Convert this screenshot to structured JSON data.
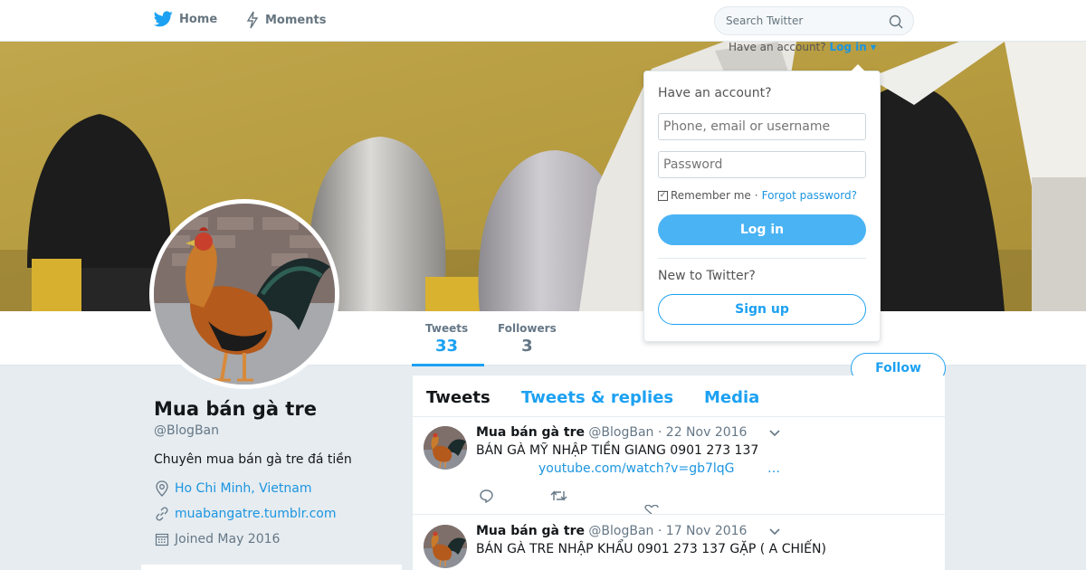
{
  "nav": {
    "home": "Home",
    "moments": "Moments",
    "search_placeholder": "Search Twitter"
  },
  "login_prompt": {
    "have_account": "Have an account?",
    "login": "Log in"
  },
  "dropdown": {
    "title": "Have an account?",
    "username_placeholder": "Phone, email or username",
    "password_placeholder": "Password",
    "remember": "Remember me",
    "separator": "·",
    "forgot": "Forgot password?",
    "login_button": "Log in",
    "new_to": "New to Twitter?",
    "signup_button": "Sign up"
  },
  "stats": {
    "tweets_label": "Tweets",
    "tweets_value": "33",
    "followers_label": "Followers",
    "followers_value": "3"
  },
  "follow_button": "Follow",
  "profile": {
    "name": "Mua bán gà tre",
    "handle": "@BlogBan",
    "bio": "Chuyên mua bán gà tre đá tiền",
    "location": "Ho Chi Minh, Vietnam",
    "url": "muabangatre.tumblr.com",
    "joined": "Joined May 2016"
  },
  "timeline_tabs": [
    "Tweets",
    "Tweets & replies",
    "Media"
  ],
  "tweets": [
    {
      "name": "Mua bán gà tre",
      "handle": "@BlogBan",
      "date": "· 22 Nov 2016",
      "text": "BÁN GÀ MỸ NHẬP TIỀN GIANG 0901 273 137",
      "link": "youtube.com/watch?v=gb7lqG",
      "ellipsis": "…"
    },
    {
      "name": "Mua bán gà tre",
      "handle": "@BlogBan",
      "date": "· 17 Nov 2016",
      "text": "BÁN GÀ TRE NHẬP KHẨU 0901 273 137 GẶP ( A CHIẾN)"
    }
  ],
  "colors": {
    "accent": "#1da1f2",
    "link": "#1b95e0",
    "background": "#e6ecf0",
    "login_button": "#4ab3f4"
  }
}
